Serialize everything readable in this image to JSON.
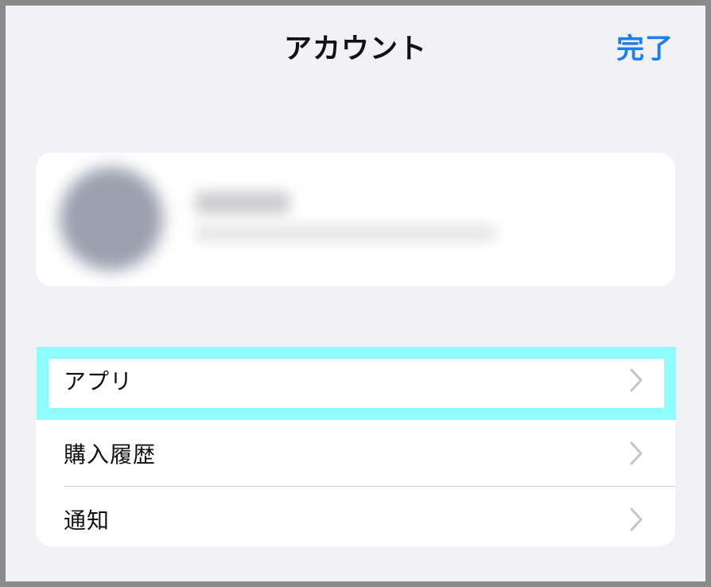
{
  "nav": {
    "title": "アカウント",
    "done_label": "完了"
  },
  "profile": {
    "name": "",
    "email": ""
  },
  "menu": {
    "items": [
      {
        "label": "アプリ",
        "icon": "chevron-right-icon"
      },
      {
        "label": "購入履歴",
        "icon": "chevron-right-icon"
      },
      {
        "label": "通知",
        "icon": "chevron-right-icon"
      }
    ]
  },
  "colors": {
    "accent": "#1a7ff5",
    "background": "#f2f2f6",
    "highlight": "#8dfdfd",
    "frame": "#8a8a8a"
  }
}
